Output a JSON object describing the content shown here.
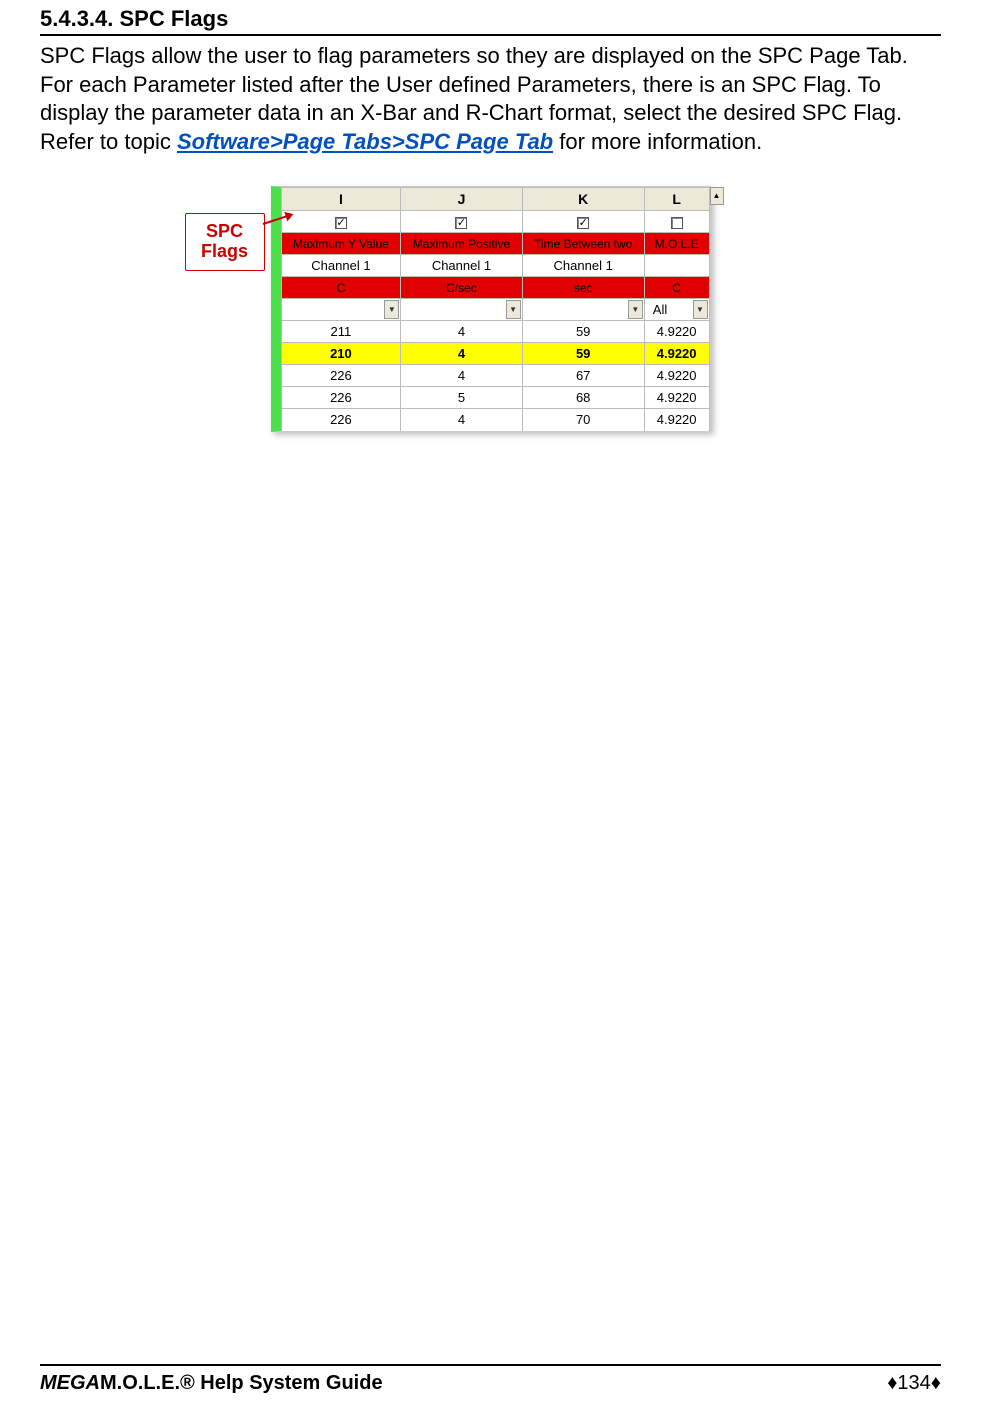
{
  "heading": "5.4.3.4. SPC Flags",
  "para": {
    "p1a": "SPC Flags allow the user to flag parameters so they are displayed on the SPC Page Tab. For each Parameter listed after the User defined Parameters, there is an SPC Flag. To display the parameter data in an X-Bar and R-Chart format, select the desired SPC Flag. Refer to topic ",
    "link": "Software>Page Tabs>SPC Page Tab",
    "p1b": " for more information."
  },
  "callout": {
    "line1": "SPC",
    "line2": "Flags"
  },
  "columns": {
    "i": "I",
    "j": "J",
    "k": "K",
    "l": "L"
  },
  "checks": {
    "i": "✓",
    "j": "✓",
    "k": "✓",
    "l": ""
  },
  "params": {
    "i": "Maximum Y Value",
    "j": "Maximum Positive",
    "k": "Time Between two",
    "l": "M.O.L.E"
  },
  "channels": {
    "i": "Channel 1",
    "j": "Channel 1",
    "k": "Channel 1"
  },
  "units": {
    "i": "C",
    "j": "C/sec",
    "k": "sec",
    "l": "C"
  },
  "filters": {
    "l": "All"
  },
  "rows": [
    {
      "i": "211",
      "j": "4",
      "k": "59",
      "l": "4.9220",
      "hl": false
    },
    {
      "i": "210",
      "j": "4",
      "k": "59",
      "l": "4.9220",
      "hl": true
    },
    {
      "i": "226",
      "j": "4",
      "k": "67",
      "l": "4.9220",
      "hl": false
    },
    {
      "i": "226",
      "j": "5",
      "k": "68",
      "l": "4.9220",
      "hl": false
    },
    {
      "i": "226",
      "j": "4",
      "k": "70",
      "l": "4.9220",
      "hl": false
    }
  ],
  "footer": {
    "left_prefix": "MEGA",
    "left_rest": "M.O.L.E.® Help System Guide",
    "right": "♦134♦"
  }
}
